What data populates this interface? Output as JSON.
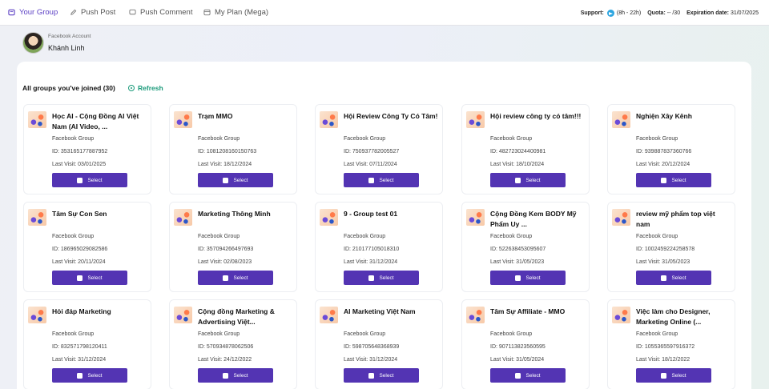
{
  "nav": {
    "tabs": [
      {
        "label": "Your Group",
        "icon": "group-icon",
        "active": true
      },
      {
        "label": "Push Post",
        "icon": "edit-icon",
        "active": false
      },
      {
        "label": "Push Comment",
        "icon": "comment-icon",
        "active": false
      },
      {
        "label": "My Plan (Mega)",
        "icon": "plan-icon",
        "active": false
      }
    ]
  },
  "status": {
    "support_label": "Support:",
    "support_hours": "(8h - 22h)",
    "quota_label": "Quota:",
    "quota_value": "-- /30",
    "expiration_label": "Expiration date:",
    "expiration_value": "31/07/2025"
  },
  "account": {
    "label": "Facebook Account",
    "name": "Khánh Linh"
  },
  "groups_header": {
    "title": "All groups you've joined (30)",
    "refresh_label": "Refresh"
  },
  "colors": {
    "accent": "#5b3fc4",
    "button": "#5334b3",
    "refresh": "#1a9a7a"
  },
  "groups": [
    {
      "name": "Học AI - Cộng Đồng AI Việt Nam (AI Video, ...",
      "type": "Facebook Group",
      "id": "ID: 353165177887952",
      "last_visit": "Last Visit: 03/01/2025",
      "select_label": "Select"
    },
    {
      "name": "Trạm MMO",
      "type": "Facebook Group",
      "id": "ID: 1081208160150763",
      "last_visit": "Last Visit: 18/12/2024",
      "select_label": "Select"
    },
    {
      "name": "Hội Review Công Ty Có Tâm!",
      "type": "Facebook Group",
      "id": "ID: 750937782005527",
      "last_visit": "Last Visit: 07/11/2024",
      "select_label": "Select"
    },
    {
      "name": "Hội review công ty có tâm!!!",
      "type": "Facebook Group",
      "id": "ID: 482723024400981",
      "last_visit": "Last Visit: 18/10/2024",
      "select_label": "Select"
    },
    {
      "name": "Nghiện Xây Kênh",
      "type": "Facebook Group",
      "id": "ID: 939887837360766",
      "last_visit": "Last Visit: 20/12/2024",
      "select_label": "Select"
    },
    {
      "name": "Tâm Sự Con Sen",
      "type": "Facebook Group",
      "id": "ID: 186965029082586",
      "last_visit": "Last Visit: 20/11/2024",
      "select_label": "Select"
    },
    {
      "name": "Marketing Thông Minh",
      "type": "Facebook Group",
      "id": "ID: 357094266497693",
      "last_visit": "Last Visit: 02/08/2023",
      "select_label": "Select"
    },
    {
      "name": "9 - Group test 01",
      "type": "Facebook Group",
      "id": "ID: 210177105018310",
      "last_visit": "Last Visit: 31/12/2024",
      "select_label": "Select"
    },
    {
      "name": "Cộng Đồng Kem BODY Mỹ Phẩm Uy ...",
      "type": "Facebook Group",
      "id": "ID: 522638453095607",
      "last_visit": "Last Visit: 31/05/2023",
      "select_label": "Select"
    },
    {
      "name": "review mỹ phẩm top việt nam",
      "type": "Facebook Group",
      "id": "ID: 1002459224258578",
      "last_visit": "Last Visit: 31/05/2023",
      "select_label": "Select"
    },
    {
      "name": "Hỏi đáp Marketing",
      "type": "Facebook Group",
      "id": "ID: 832571798120411",
      "last_visit": "Last Visit: 31/12/2024",
      "select_label": "Select"
    },
    {
      "name": "Cộng đồng Marketing & Advertising Việt...",
      "type": "Facebook Group",
      "id": "ID: 570934878062506",
      "last_visit": "Last Visit: 24/12/2022",
      "select_label": "Select"
    },
    {
      "name": "AI Marketing Việt Nam",
      "type": "Facebook Group",
      "id": "ID: 598705648368939",
      "last_visit": "Last Visit: 31/12/2024",
      "select_label": "Select"
    },
    {
      "name": "Tâm Sự Affiliate - MMO",
      "type": "Facebook Group",
      "id": "ID: 907113823560595",
      "last_visit": "Last Visit: 31/05/2024",
      "select_label": "Select"
    },
    {
      "name": "Việc làm cho Designer, Marketing Online (...",
      "type": "Facebook Group",
      "id": "ID: 1055365597916372",
      "last_visit": "Last Visit: 18/12/2022",
      "select_label": "Select"
    }
  ]
}
